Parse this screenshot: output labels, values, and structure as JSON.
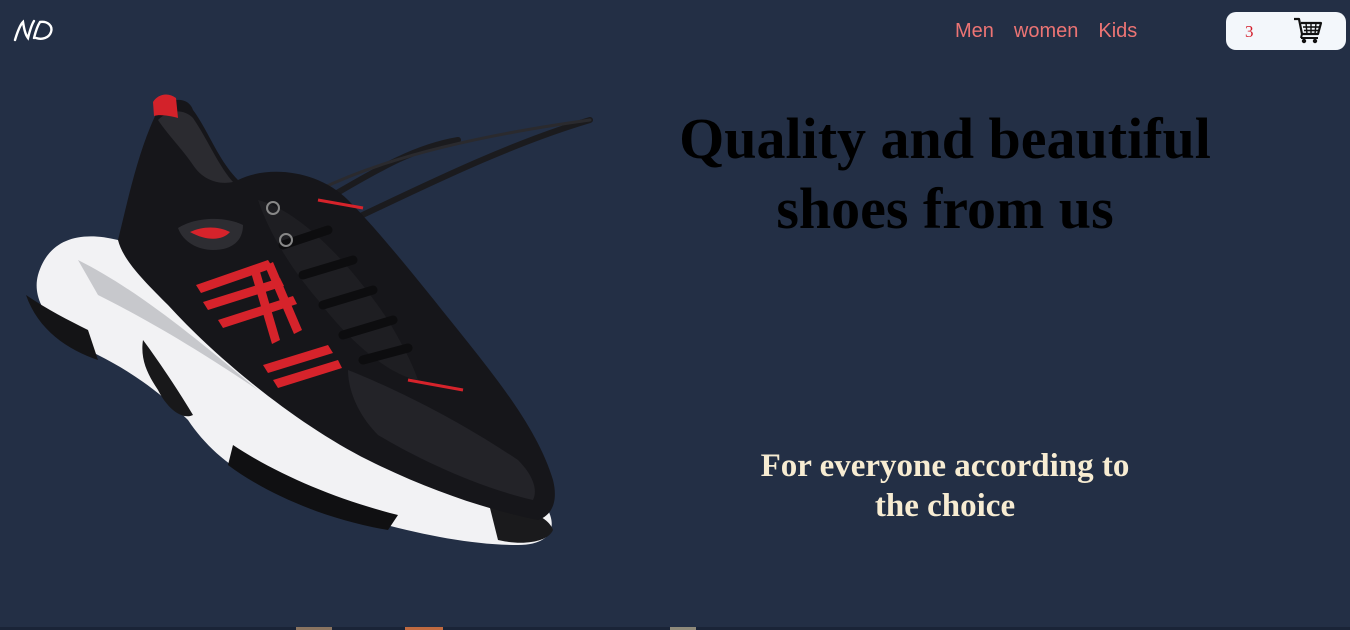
{
  "header": {
    "logo_text": "ND",
    "nav": {
      "men": "Men",
      "women": "women",
      "kids": "Kids"
    },
    "cart": {
      "count": "3",
      "icon": "shopping-cart-icon"
    }
  },
  "hero": {
    "headline": "Quality and beautiful shoes from us",
    "subline": "For everyone according to the choice",
    "image": "black-red-sneaker"
  },
  "colors": {
    "background": "#232f45",
    "nav_text": "#ec7474",
    "cart_bg": "#f3f7fb",
    "cart_count": "#d41f2c",
    "headline": "#000000",
    "subline": "#f7ecd2"
  }
}
